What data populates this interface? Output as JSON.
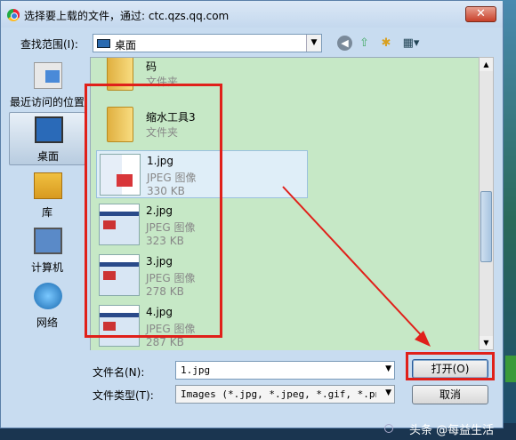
{
  "window": {
    "title": "选择要上载的文件，通过: ctc.qzs.qq.com",
    "close": "✕"
  },
  "lookin": {
    "label": "查找范围(I):",
    "value": "桌面"
  },
  "toolbar": {
    "back": "◀",
    "up": "⇧",
    "newfolder": "✱",
    "views": "▦▾"
  },
  "places": [
    {
      "label": "最近访问的位置"
    },
    {
      "label": "桌面"
    },
    {
      "label": "库"
    },
    {
      "label": "计算机"
    },
    {
      "label": "网络"
    }
  ],
  "files": [
    {
      "name": "码",
      "type": "文件夹",
      "size": ""
    },
    {
      "name": "缩水工具3",
      "type": "文件夹",
      "size": ""
    },
    {
      "name": "1.jpg",
      "type": "JPEG 图像",
      "size": "330 KB"
    },
    {
      "name": "2.jpg",
      "type": "JPEG 图像",
      "size": "323 KB"
    },
    {
      "name": "3.jpg",
      "type": "JPEG 图像",
      "size": "278 KB"
    },
    {
      "name": "4.jpg",
      "type": "JPEG 图像",
      "size": "287 KB"
    }
  ],
  "filename": {
    "label": "文件名(N):",
    "value": "1.jpg"
  },
  "filetype": {
    "label": "文件类型(T):",
    "value": "Images (*.jpg, *.jpeg, *.gif, *.png,"
  },
  "buttons": {
    "open": "打开(O)",
    "cancel": "取消"
  },
  "watermark": "头条 @每益生活"
}
